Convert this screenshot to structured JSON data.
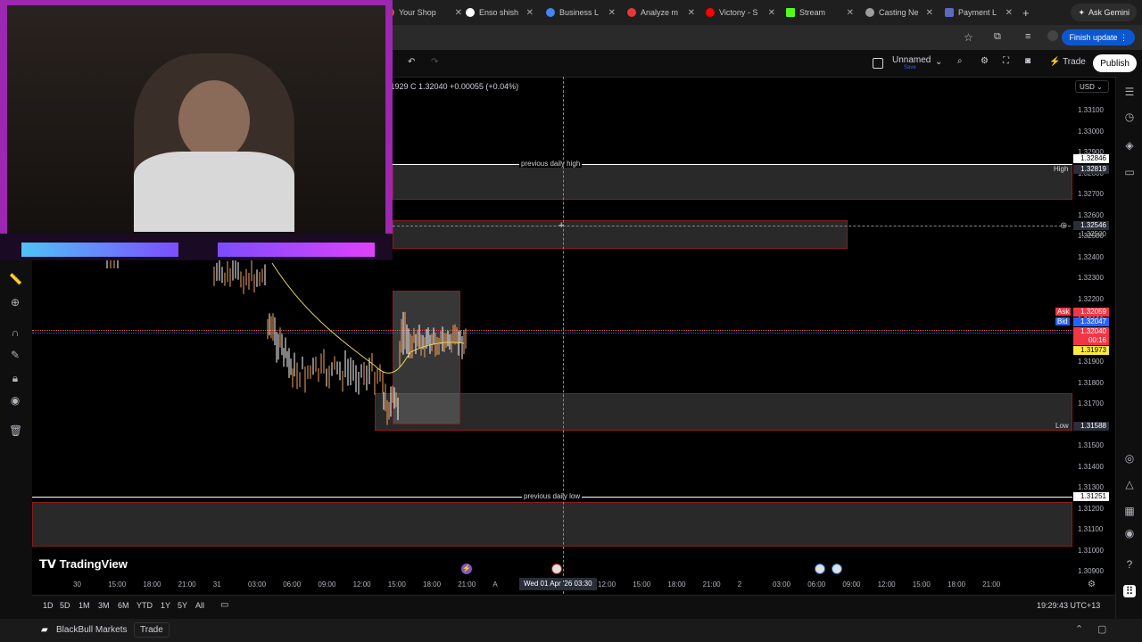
{
  "browser": {
    "tabs": [
      {
        "label": "Your Shop",
        "color": "#e65100"
      },
      {
        "label": "Enso shish",
        "color": "#ffffff"
      },
      {
        "label": "Business L",
        "color": "#4285f4"
      },
      {
        "label": "Analyze m",
        "color": "#e53935"
      },
      {
        "label": "Victony - S",
        "color": "#ff0000"
      },
      {
        "label": "Stream",
        "color": "#53fc18"
      },
      {
        "label": "Casting Ne",
        "color": "#9e9e9e"
      },
      {
        "label": "Payment L",
        "color": "#5c6bc0"
      }
    ],
    "ask_gemini": "Ask Gemini",
    "finish_update": "Finish update"
  },
  "tv": {
    "layout_name": "Unnamed",
    "layout_sub": "Save",
    "trade": "Trade",
    "publish": "Publish",
    "currency": "USD",
    "ohlc": ".31929  C 1.32040  +0.00055 (+0.04%)",
    "brand": "TradingView",
    "clock": "19:29:43 UTC+13",
    "crosshair_date": "Wed 01 Apr '26  03:30",
    "broker": "BlackBull Markets",
    "broker_trade": "Trade"
  },
  "chart_data": {
    "type": "candlestick",
    "price_ticks": [
      "1.33100",
      "1.33000",
      "1.32900",
      "1.32800",
      "1.32700",
      "1.32600",
      "1.32500",
      "1.32400",
      "1.32300",
      "1.32200",
      "1.32100",
      "1.32000",
      "1.31900",
      "1.31800",
      "1.31700",
      "1.31600",
      "1.31500",
      "1.31400",
      "1.31300",
      "1.31200",
      "1.31100",
      "1.31000",
      "1.30900"
    ],
    "time_ticks": [
      "30",
      "15:00",
      "18:00",
      "21:00",
      "31",
      "03:00",
      "06:00",
      "09:00",
      "12:00",
      "15:00",
      "18:00",
      "21:00",
      "A",
      "",
      "09:00",
      "12:00",
      "15:00",
      "18:00",
      "21:00",
      "2",
      "03:00",
      "06:00",
      "09:00",
      "12:00",
      "15:00",
      "18:00",
      "21:00"
    ],
    "timeframes": [
      "1D",
      "5D",
      "1M",
      "3M",
      "6M",
      "YTD",
      "1Y",
      "5Y",
      "All"
    ],
    "labels": {
      "prev_high": "previous daily high",
      "prev_low": "previous daily low"
    },
    "price_labels": {
      "top": "1.32846",
      "high_tag": "High",
      "high": "1.32819",
      "cross": "1.32546",
      "cross2": "1.32500",
      "ask_tag": "Ask",
      "ask": "1.32059",
      "bid_tag": "Bid",
      "bid": "1.32047",
      "last": "1.32040",
      "countdown": "00:16",
      "ma": "1.31973",
      "low_tag": "Low",
      "low": "1.31588",
      "prev_low": "1.31251"
    }
  }
}
